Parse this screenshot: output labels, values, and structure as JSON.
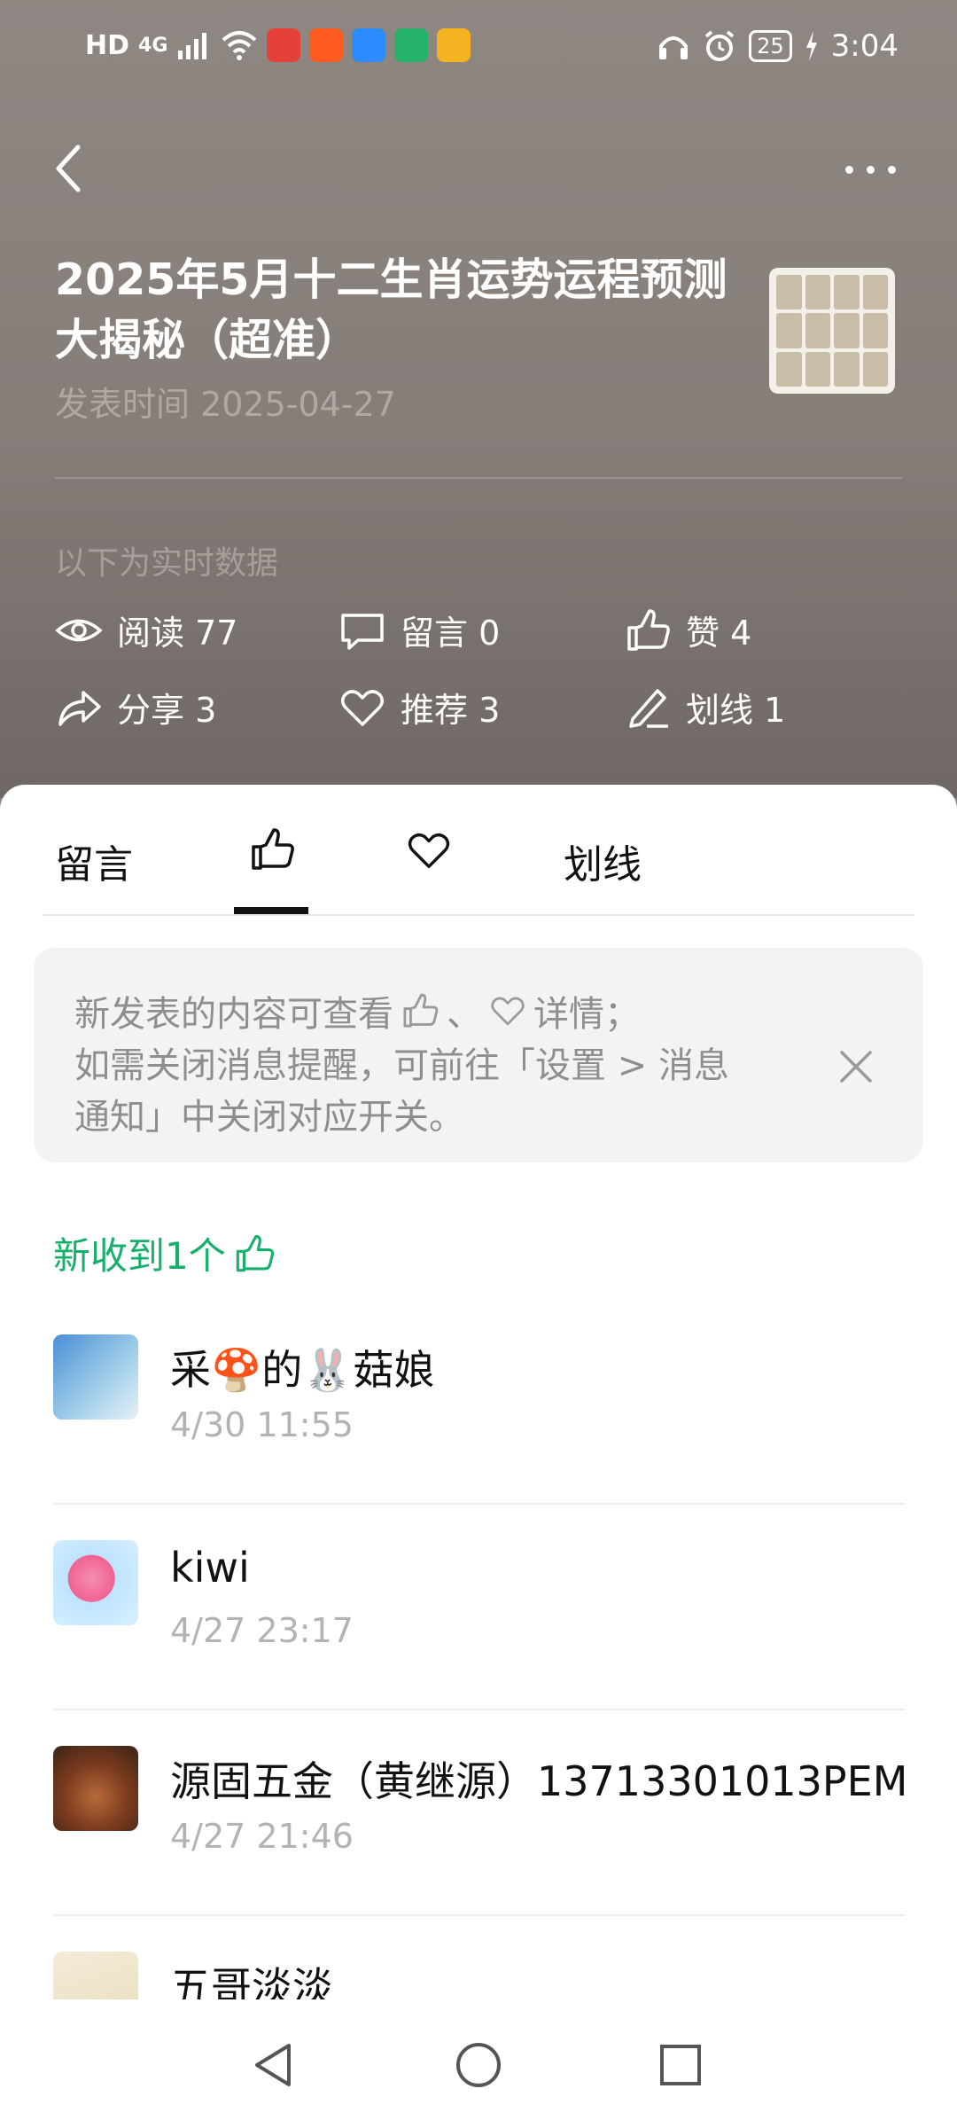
{
  "status_bar": {
    "hd": "HD",
    "network": "4G",
    "battery": "25",
    "time": "3:04",
    "app_icons": [
      "taobao-icon",
      "shop-icon",
      "browser-icon",
      "chat-icon",
      "weibo-icon"
    ]
  },
  "header": {
    "title": "2025年5月十二生肖运势运程预测大揭秘（超准）",
    "publish_date": "发表时间 2025-04-27",
    "realtime_label": "以下为实时数据"
  },
  "stats": {
    "read": "阅读 77",
    "comment": "留言 0",
    "like": "赞 4",
    "share": "分享 3",
    "recommend": "推荐 3",
    "underline": "划线 1"
  },
  "tabs": {
    "comments": "留言",
    "underline": "划线",
    "active": "like"
  },
  "notice": {
    "line1_a": "新发表的内容可查看",
    "line1_b": "、",
    "line1_c": "详情；",
    "line2": "如需关闭消息提醒，可前往「设置 > 消息",
    "line3": "通知」中关闭对应开关。"
  },
  "new_count": "新收到1个",
  "users": [
    {
      "name": "采🍄的🐰菇娘",
      "time": "4/30 11:55"
    },
    {
      "name": "kiwi",
      "time": "4/27 23:17"
    },
    {
      "name": "源固五金（黄继源）13713301013PEM",
      "time": "4/27 21:46"
    },
    {
      "name": "五哥淡淡",
      "time": ""
    }
  ],
  "colors": {
    "accent_green": "#17b06b",
    "header_bg": "#8d8681"
  }
}
